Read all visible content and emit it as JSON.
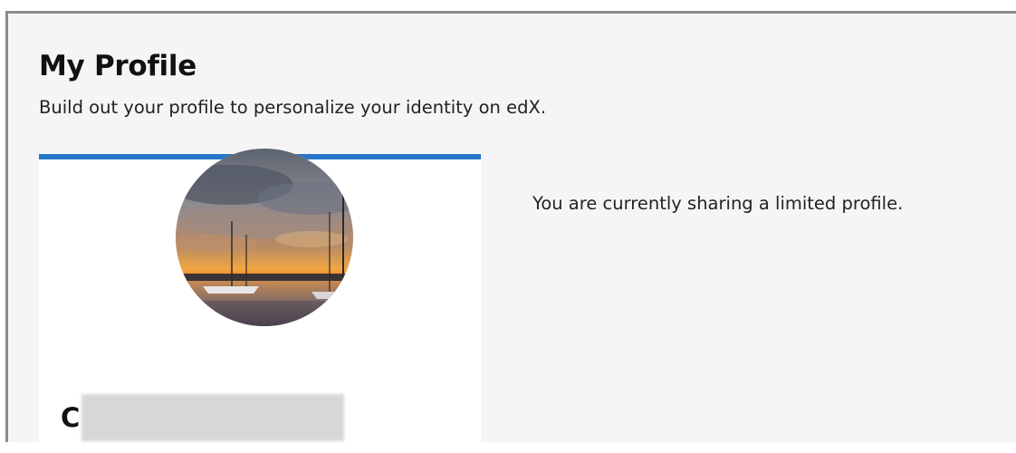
{
  "header": {
    "title": "My Profile",
    "subtitle": "Build out your profile to personalize your identity on edX."
  },
  "profile_card": {
    "name_initial": "C",
    "name_redacted": true,
    "avatar_icon": "profile-photo-sunset-harbor",
    "accent_color": "#2676c8"
  },
  "sharing_notice": "You are currently sharing a limited profile."
}
